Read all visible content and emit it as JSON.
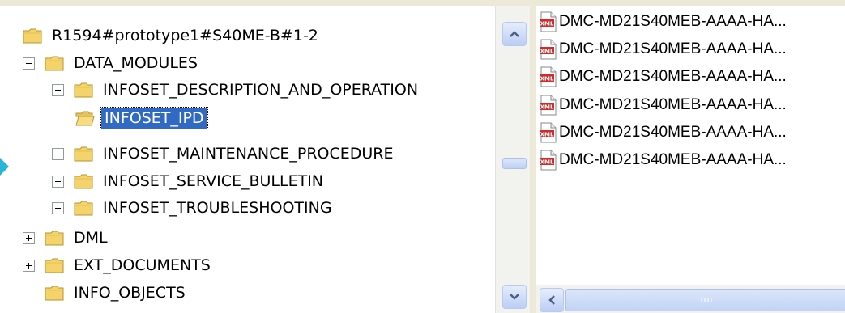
{
  "tree": {
    "root": "R1594#prototype1#S40ME-B#1-2",
    "items": [
      {
        "label": "DATA_MODULES",
        "expander": "minus",
        "level": 1
      },
      {
        "label": "INFOSET_DESCRIPTION_AND_OPERATION",
        "expander": "plus",
        "level": 2
      },
      {
        "label": "INFOSET_IPD",
        "expander": "none",
        "level": 2,
        "selected": true
      },
      {
        "label": "INFOSET_MAINTENANCE_PROCEDURE",
        "expander": "plus",
        "level": 2
      },
      {
        "label": "INFOSET_SERVICE_BULLETIN",
        "expander": "plus",
        "level": 2
      },
      {
        "label": "INFOSET_TROUBLESHOOTING",
        "expander": "plus",
        "level": 2
      },
      {
        "label": "DML",
        "expander": "plus",
        "level": 1
      },
      {
        "label": "EXT_DOCUMENTS",
        "expander": "plus",
        "level": 1
      },
      {
        "label": "INFO_OBJECTS",
        "expander": "none",
        "level": 1
      }
    ]
  },
  "files": {
    "icon": "xml-file-icon",
    "items": [
      "DMC-MD21S40MEB-AAAA-HA...",
      "DMC-MD21S40MEB-AAAA-HA...",
      "DMC-MD21S40MEB-AAAA-HA...",
      "DMC-MD21S40MEB-AAAA-HA...",
      "DMC-MD21S40MEB-AAAA-HA...",
      "DMC-MD21S40MEB-AAAA-HA..."
    ]
  },
  "colors": {
    "selection": "#316ac5",
    "folder": "#f5d36b",
    "pointer_arrow": "#27b6d9",
    "xml_badge": "#d22b2b"
  }
}
